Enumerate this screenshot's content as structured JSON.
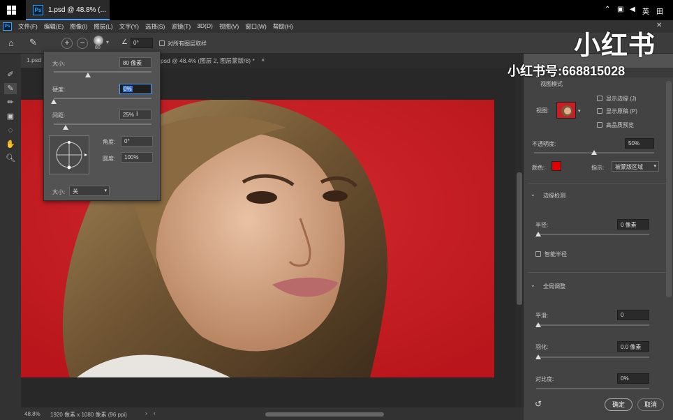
{
  "taskbar": {
    "tab_title": "1.psd @ 48.8% (...",
    "tray_lang": "英",
    "tray_ime": "田"
  },
  "menubar": {
    "items": [
      "文件(F)",
      "编辑(E)",
      "图像(I)",
      "图层(L)",
      "文字(Y)",
      "选择(S)",
      "滤镜(T)",
      "3D(D)",
      "视图(V)",
      "窗口(W)",
      "帮助(H)"
    ]
  },
  "optionsbar": {
    "brush_size": "80",
    "angle_value": "0°",
    "sample_all_layers_label": "对所有图层取样"
  },
  "doc_tabs": {
    "tab1": "1.psd",
    "tab2": "psd @ 48.4% (图层 2, 图层蒙版/8) *",
    "tab2_close": "×"
  },
  "brush_popup": {
    "size_label": "大小:",
    "size_value": "80 像素",
    "size_level": 0.35,
    "hardness_label": "硬度:",
    "hardness_value": "0%",
    "hardness_level": 0.0,
    "spacing_label": "间距:",
    "spacing_value": "25%",
    "spacing_level": 0.12,
    "angle_label": "角度:",
    "angle_value": "0°",
    "roundness_label": "圆度:",
    "roundness_value": "100%",
    "size_control_label": "大小:",
    "size_control_value": "关"
  },
  "right_panel": {
    "view_mode_section": "视图模式",
    "view_label": "视图:",
    "show_edge_label": "显示边缘 (J)",
    "show_original_label": "显示原稿 (P)",
    "hq_preview_label": "高品质预览",
    "opacity_label": "不透明度:",
    "opacity_value": "50%",
    "opacity_level": 0.5,
    "color_label": "颜色:",
    "color_swatch": "#e00000",
    "indicate_label": "指示:",
    "indicate_value": "被蒙版区域",
    "edge_detect_section": "边缘检测",
    "radius_label": "半径:",
    "radius_value": "0 像素",
    "smart_radius_label": "智能半径",
    "global_refine_section": "全局调整",
    "smooth_label": "平滑:",
    "smooth_value": "0",
    "feather_label": "羽化:",
    "feather_value": "0.0 像素",
    "contrast_label": "对比度:",
    "contrast_value": "0%",
    "ok_label": "确定",
    "cancel_label": "取消"
  },
  "statusbar": {
    "zoom": "48.8%",
    "doc_info": "1920 像素 x 1080 像素 (96 ppi)"
  },
  "watermark": {
    "brand": "小红书",
    "account": "小红书号:668815028"
  },
  "colors": {
    "canvas_background": "#c61e24",
    "accent": "#31a8ff"
  }
}
